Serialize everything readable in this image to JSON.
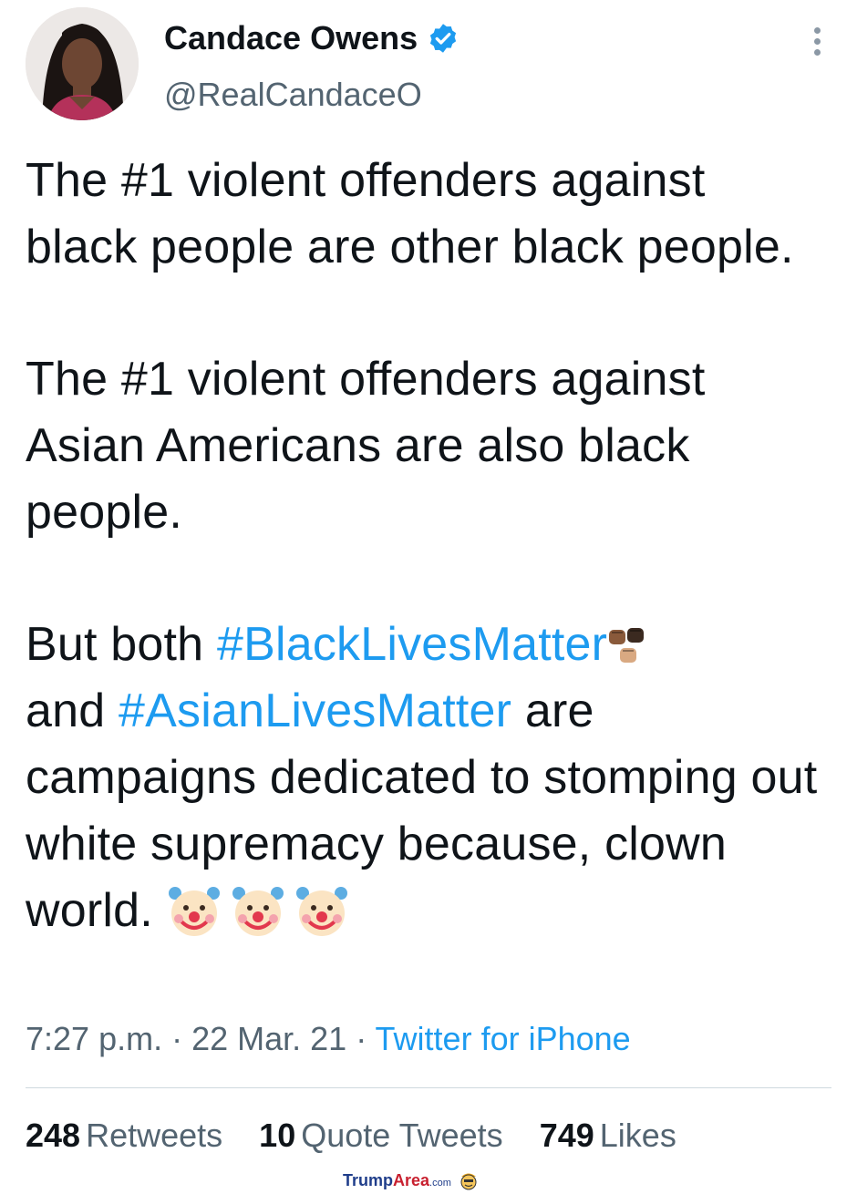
{
  "tweet": {
    "author_name": "Candace Owens",
    "handle": "@RealCandaceO",
    "paragraph1": "The #1 violent offenders against black people are other black people.",
    "paragraph2": "The #1 violent offenders against Asian Americans are also black people.",
    "p3_but_both": "But both ",
    "hashtag1": "#BlackLivesMatter",
    "p3_and": "and ",
    "hashtag2": "#AsianLivesMatter",
    "p3_rest": " are campaigns dedicated to stomping out white supremacy because, clown world.",
    "time": "7:27 p.m.",
    "date": "22 Mar. 21",
    "source": "Twitter for iPhone",
    "separator": " · "
  },
  "stats": {
    "retweets_count": "248",
    "retweets_label": "Retweets",
    "quotes_count": "10",
    "quotes_label": "Quote Tweets",
    "likes_count": "749",
    "likes_label": "Likes"
  },
  "watermark": {
    "part1": "Trump",
    "part2": "Area",
    "part3": ".com"
  },
  "colors": {
    "link_blue": "#1d9bf0",
    "text": "#0f1419",
    "secondary": "#536471",
    "divider": "#cfd9de"
  },
  "icons": [
    "verified-badge-icon",
    "more-options-icon",
    "raised-fists-emoji",
    "clown-face-emoji",
    "watermark-face-icon"
  ]
}
